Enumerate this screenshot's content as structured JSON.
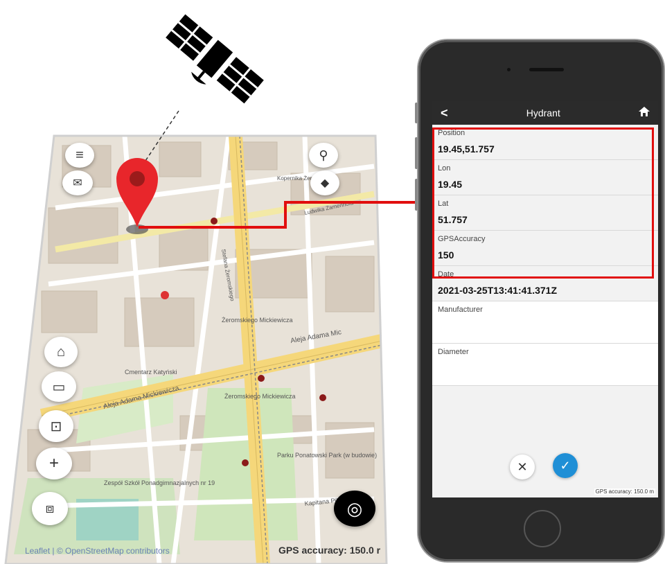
{
  "map": {
    "labels": [
      "Aleja Adama Mickiewicza",
      "Aleja Adama Mic",
      "Żeromskiego Mickiewicza",
      "Żeromskiego Mickiewicza",
      "Kopernika Żeromskiego",
      "Ludwika Zamenhofa",
      "Stefana Żeromskiego",
      "Parku Ponatowski Park (w budowie)",
      "Zespół Szkół Ponadgimnazjalnych nr 19",
      "Kapitana Pilota",
      "Cmentarz Katyński"
    ],
    "credit": "Leaflet | © OpenStreetMap contributors",
    "gps_accuracy": "GPS accuracy: 150.0 r",
    "buttons": {
      "menu": "≡",
      "briefcase": "✉",
      "search": "⚲",
      "layers": "◆",
      "measure_area": "⌂",
      "ruler": "▭",
      "delete": "⊡",
      "add": "+",
      "draw_polygon": "⧈",
      "locate": "◎"
    }
  },
  "form": {
    "title": "Hydrant",
    "back": "<",
    "home": "⌂",
    "fields": [
      {
        "label": "Position",
        "value": "19.45,51.757"
      },
      {
        "label": "Lon",
        "value": "19.45"
      },
      {
        "label": "Lat",
        "value": "51.757"
      },
      {
        "label": "GPSAccuracy",
        "value": "150"
      },
      {
        "label": "Date",
        "value": "2021-03-25T13:41:41.371Z"
      },
      {
        "label": "Manufacturer",
        "value": ""
      },
      {
        "label": "Diameter",
        "value": ""
      }
    ],
    "cancel": "✕",
    "confirm": "✓",
    "gps_accuracy": "GPS accuracy: 150.0 m"
  },
  "colors": {
    "highlight": "#e10e0e",
    "pin": "#e8262b",
    "confirm": "#1f8fd6",
    "road_major": "#f7e08a",
    "road_arterial": "#e8e0a0",
    "park": "#cde6b8",
    "building": "#d9cfc2"
  }
}
